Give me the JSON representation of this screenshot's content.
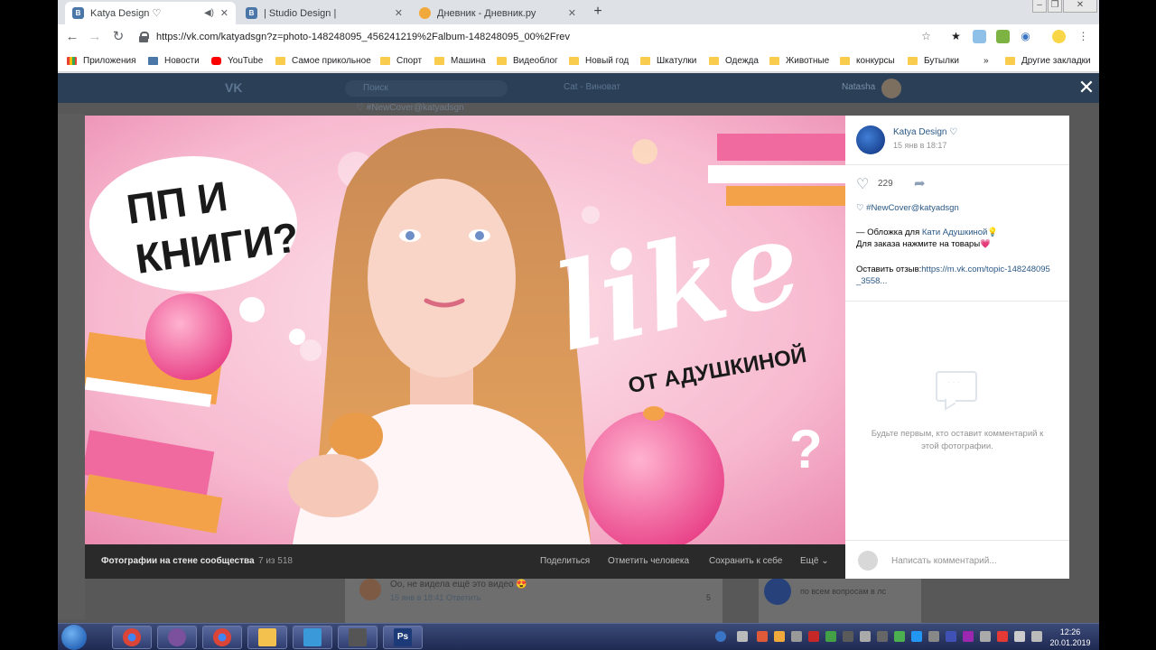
{
  "browser": {
    "tabs": [
      {
        "title": "Katya Design ♡",
        "favicon_color": "#4a76a8"
      },
      {
        "title": "| Studio Design |",
        "favicon_color": "#4a76a8"
      },
      {
        "title": "Дневник - Дневник.ру",
        "favicon_color": "#f2a93b"
      }
    ],
    "url": "https://vk.com/katyadsgn?z=photo-148248095_456241219%2Falbum-148248095_00%2Frev",
    "bookmarks": [
      {
        "label": "Приложения",
        "icon": "apps-grid-icon"
      },
      {
        "label": "Новости",
        "icon": "vk-icon"
      },
      {
        "label": "YouTube",
        "icon": "youtube-icon"
      },
      {
        "label": "Самое прикольное",
        "icon": "folder-icon"
      },
      {
        "label": "Спорт",
        "icon": "folder-icon"
      },
      {
        "label": "Машина",
        "icon": "folder-icon"
      },
      {
        "label": "Видеоблог",
        "icon": "folder-icon"
      },
      {
        "label": "Новый год",
        "icon": "folder-icon"
      },
      {
        "label": "Шкатулки",
        "icon": "folder-icon"
      },
      {
        "label": "Одежда",
        "icon": "folder-icon"
      },
      {
        "label": "Животные",
        "icon": "folder-icon"
      },
      {
        "label": "конкурсы",
        "icon": "folder-icon"
      },
      {
        "label": "Бутылки",
        "icon": "folder-icon"
      }
    ],
    "bookmarks_more": "»",
    "other_bookmarks": "Другие закладки"
  },
  "vk": {
    "header": {
      "logo": "VK",
      "search_placeholder": "Поиск",
      "player": "Cat - Виноват",
      "user": "Natasha"
    },
    "bg_tag": "♡ #NewCover@katyadsgn",
    "bg_post": {
      "text": "Оо, не видела ещё это видео 😍",
      "meta": "15 янв в 18:41   Ответить",
      "likes": "5"
    },
    "bg_side": {
      "text": "по всем вопросам в лс"
    }
  },
  "viewer": {
    "photo_text": {
      "line1": "ПП И",
      "line2": "КНИГИ?",
      "like": "like",
      "from": "ОТ АДУШКИНОЙ"
    },
    "album_label": "Фотографии на стене сообщества",
    "counter": "7 из 518",
    "actions": {
      "share": "Поделиться",
      "tag": "Отметить человека",
      "save": "Сохранить к себе",
      "more": "Ещё ⌄"
    },
    "post": {
      "author": "Katya Design ♡",
      "date": "15 янв в 18:17",
      "likes": "229",
      "hashtag": "♡ #NewCover@katyadsgn",
      "line1_prefix": "— Обложка для ",
      "line1_link": "Кати Адушкиной",
      "line1_emoji": "💡",
      "line2": "Для заказа нажмите на товары💗",
      "review_prefix": "Оставить отзыв:",
      "review_link": "https://m.vk.com/topic-148248095_3558..."
    },
    "empty_comments": "Будьте первым, кто оставит комментарий к этой фотографии.",
    "comment_placeholder": "Написать комментарий..."
  },
  "taskbar": {
    "apps": [
      {
        "name": "chrome",
        "color": "#dd4b39"
      },
      {
        "name": "viber",
        "color": "#7b519d"
      },
      {
        "name": "chrome2",
        "color": "#dd4b39"
      },
      {
        "name": "explorer",
        "color": "#f2c14e"
      },
      {
        "name": "desktop",
        "color": "#3a9ad9"
      },
      {
        "name": "printer",
        "color": "#555555"
      },
      {
        "name": "photoshop",
        "color": "#1c3a78"
      }
    ],
    "time": "12:26",
    "date": "20.01.2019"
  },
  "colors": {
    "vk_header": "#2b3f56",
    "vk_link": "#2a5885",
    "photo_pink": "#f4b8cd"
  }
}
